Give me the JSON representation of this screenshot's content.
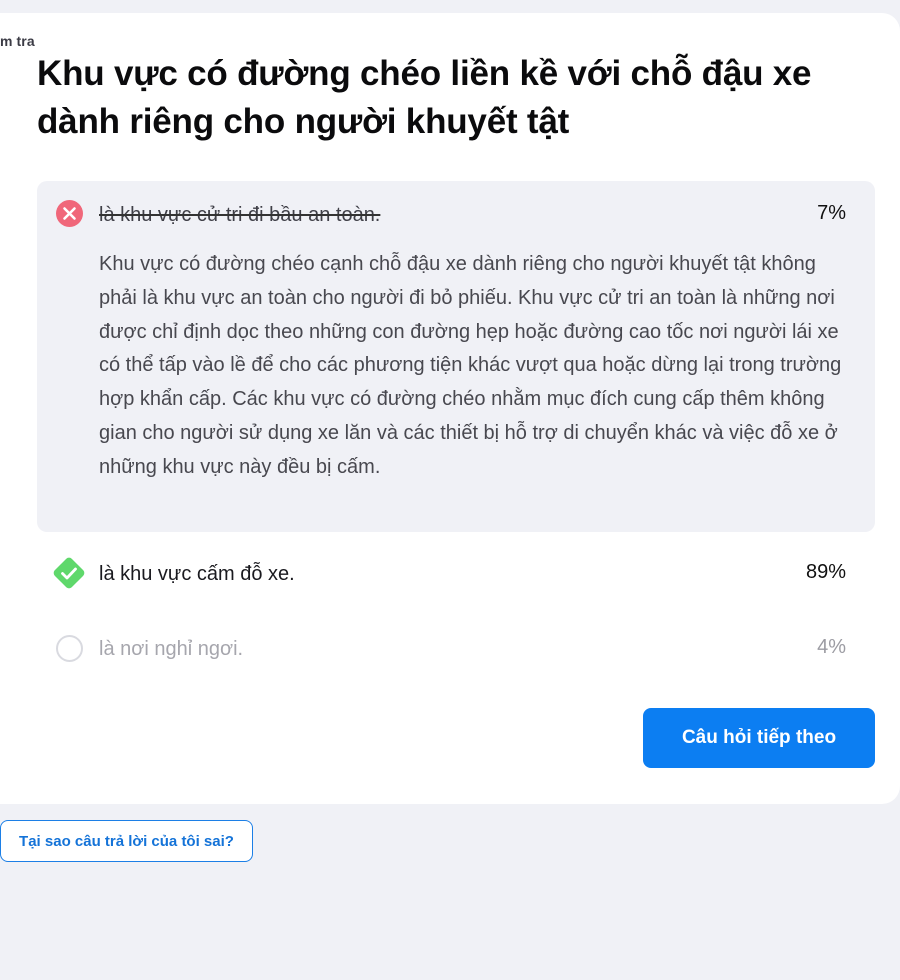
{
  "header": {
    "cut_label": "m tra"
  },
  "question": {
    "text": "Khu vực có đường chéo liền kề với chỗ đậu xe dành riêng cho người khuyết tật"
  },
  "answers": [
    {
      "text": "là khu vực cử tri đi bầu an toàn.",
      "percent": "7%",
      "state": "selected-wrong",
      "icon": "x-circle-icon",
      "explanation": "Khu vực có đường chéo cạnh chỗ đậu xe dành riêng cho người khuyết tật không phải là khu vực an toàn cho người đi bỏ phiếu. Khu vực cử tri an toàn là những nơi được chỉ định dọc theo những con đường hẹp hoặc đường cao tốc nơi người lái xe có thể tấp vào lề để cho các phương tiện khác vượt qua hoặc dừng lại trong trường hợp khẩn cấp. Các khu vực có đường chéo nhằm mục đích cung cấp thêm không gian cho người sử dụng xe lăn và các thiết bị hỗ trợ di chuyển khác và việc đỗ xe ở những khu vực này đều bị cấm."
    },
    {
      "text": "là khu vực cấm đỗ xe.",
      "percent": "89%",
      "state": "correct",
      "icon": "check-diamond-icon"
    },
    {
      "text": "là nơi nghỉ ngơi.",
      "percent": "4%",
      "state": "unselected",
      "icon": "radio-circle-icon"
    }
  ],
  "buttons": {
    "next": "Câu hỏi tiếp theo",
    "why_wrong": "Tại sao câu trả lời của tôi sai?"
  },
  "colors": {
    "wrong": "#f0677a",
    "correct": "#5fd86b",
    "primary": "#0c7ef2",
    "page_bg": "#f0f1f6"
  }
}
